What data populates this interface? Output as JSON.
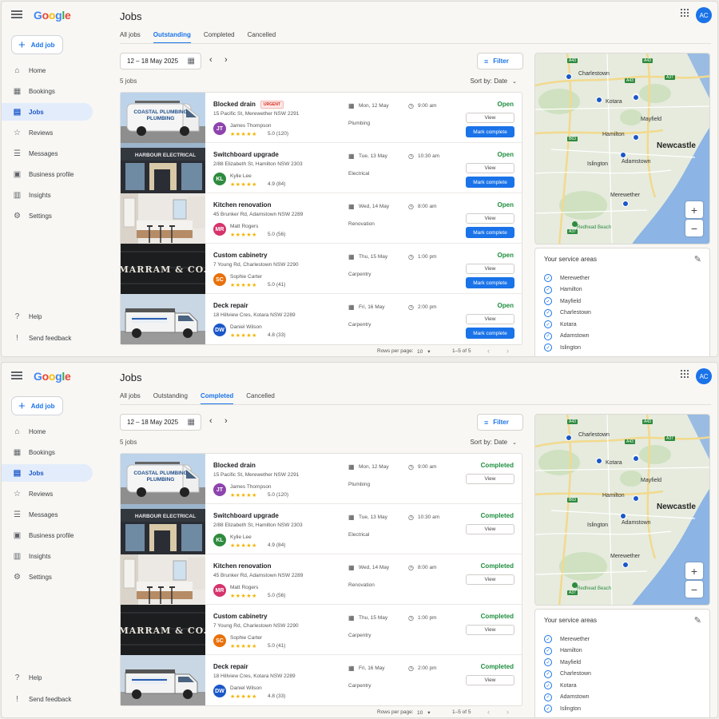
{
  "app": {
    "logo": "Google",
    "add_job_label": "Add job",
    "avatar_initials": "AC",
    "page_title": "Jobs"
  },
  "nav": [
    {
      "label": "Home",
      "icon": "home-icon"
    },
    {
      "label": "Bookings",
      "icon": "bookings-icon"
    },
    {
      "label": "Jobs",
      "icon": "jobs-icon"
    },
    {
      "label": "Reviews",
      "icon": "star-icon"
    },
    {
      "label": "Messages",
      "icon": "messages-icon"
    },
    {
      "label": "Business profile",
      "icon": "storefront-icon"
    },
    {
      "label": "Insights",
      "icon": "insights-icon"
    },
    {
      "label": "Settings",
      "icon": "settings-icon"
    }
  ],
  "nav_bottom": [
    {
      "label": "Help",
      "icon": "help-icon"
    },
    {
      "label": "Send feedback",
      "icon": "feedback-icon"
    }
  ],
  "tabs": [
    "All jobs",
    "Outstanding",
    "Completed",
    "Cancelled"
  ],
  "toolbar": {
    "date_range": "12 – 18 May 2025",
    "filter_label": "Filter",
    "job_count": "5 jobs",
    "sort_label": "Sort by: Date"
  },
  "jobs": [
    {
      "title": "Blocked drain",
      "urgent": "URGENT",
      "address": "15 Pacific St, Merewether NSW 2291",
      "initials": "JT",
      "avatar_color": "#8e44ad",
      "person": "James Thompson",
      "rating": "5.0 (120)",
      "category": "Plumbing",
      "out_date": "Mon, 12 May",
      "comp_date": "Mon, 12 May",
      "time": "9:00 am",
      "thumb": "van"
    },
    {
      "title": "Switchboard upgrade",
      "urgent": "",
      "address": "2/88 Elizabeth St, Hamilton NSW 2303",
      "initials": "KL",
      "avatar_color": "#2e8b3e",
      "person": "Kylie Lee",
      "rating": "4.9 (84)",
      "category": "Electrical",
      "out_date": "Tue, 13 May",
      "comp_date": "Tue, 13 May",
      "time": "10:30 am",
      "thumb": "shop"
    },
    {
      "title": "Kitchen renovation",
      "urgent": "",
      "address": "45 Brunker Rd, Adamstown NSW 2289",
      "initials": "MR",
      "avatar_color": "#d6336c",
      "person": "Matt Rogers",
      "rating": "5.0 (56)",
      "category": "Renovation",
      "out_date": "Wed, 14 May",
      "comp_date": "Wed, 14 May",
      "time": "8:00 am",
      "thumb": "kitchen"
    },
    {
      "title": "Custom cabinetry",
      "urgent": "",
      "address": "7 Young Rd, Charlestown NSW 2290",
      "initials": "SC",
      "avatar_color": "#e8710a",
      "person": "Sophie Carter",
      "rating": "5.0 (41)",
      "category": "Carpentry",
      "out_date": "Thu, 15 May",
      "comp_date": "Thu, 15 May",
      "time": "1:00 pm",
      "thumb": "marram"
    },
    {
      "title": "Deck repair",
      "urgent": "",
      "address": "18 Hillview Cres, Kotara NSW 2289",
      "initials": "DW",
      "avatar_color": "#1a57c8",
      "person": "Daniel Wilson",
      "rating": "4.8 (33)",
      "category": "Carpentry",
      "out_date": "Fri, 16 May",
      "comp_date": "Fri, 16 May",
      "time": "2:00 pm",
      "thumb": "truck"
    }
  ],
  "thumb_text": {
    "van": "COASTAL PLUMBING",
    "shop": "HARBOUR ELECTRICAL",
    "marram": "MARRAM & CO."
  },
  "stars": "★★★★★",
  "buttons": {
    "view": "View",
    "mark_complete": "Mark complete"
  },
  "status": {
    "outstanding": "Open",
    "completed": "Completed"
  },
  "pagination": {
    "rows_label": "Rows per page:",
    "rows_value": "10",
    "range": "1–5 of 5"
  },
  "map": {
    "labels": [
      "Charlestown",
      "Kotara",
      "Mayfield",
      "Hamilton",
      "Newcastle",
      "Adamstown",
      "Islington",
      "Merewether",
      "Redhead Beach"
    ],
    "shields": [
      "A43",
      "A43",
      "A37",
      "B63",
      "A37",
      "A43"
    ],
    "zoom_in": "+",
    "zoom_out": "−"
  },
  "service_areas": {
    "title": "Your service areas",
    "items": [
      "Merewether",
      "Hamilton",
      "Mayfield",
      "Charlestown",
      "Kotara",
      "Adamstown",
      "Islington"
    ]
  },
  "panels": [
    {
      "active_tab": "Outstanding",
      "mode": "outstanding"
    },
    {
      "active_tab": "Completed",
      "mode": "completed"
    }
  ],
  "colors": {
    "accent": "#1a73e8",
    "success": "#1e8e3e",
    "urgent": "#d93025",
    "star": "#f4b400"
  }
}
